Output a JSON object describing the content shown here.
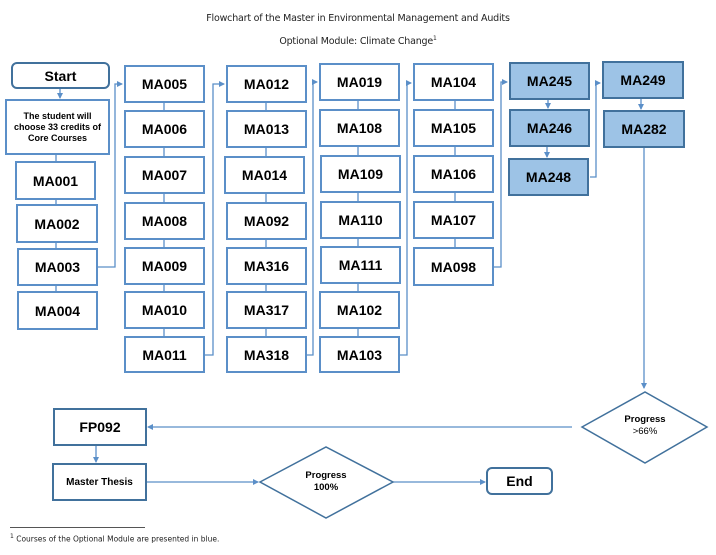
{
  "header": {
    "title": "Flowchart of the Master in Environmental Management and Audits",
    "subtitle": "Optional Module: Climate Change",
    "subtitle_marker": "1"
  },
  "colors": {
    "line": "#5b8fc8",
    "optional_fill": "#9dc3e6",
    "optional_border": "#41719c"
  },
  "start": {
    "label": "Start"
  },
  "intro": {
    "label": "The student will choose 33 credits of Core Courses"
  },
  "columns": [
    {
      "optional": false,
      "courses": [
        "MA001",
        "MA002",
        "MA003",
        "MA004"
      ]
    },
    {
      "optional": false,
      "courses": [
        "MA005",
        "MA006",
        "MA007",
        "MA008",
        "MA009",
        "MA010",
        "MA011"
      ]
    },
    {
      "optional": false,
      "courses": [
        "MA012",
        "MA013",
        "MA014",
        "MA092",
        "MA316",
        "MA317",
        "MA318"
      ]
    },
    {
      "optional": false,
      "courses": [
        "MA019",
        "MA108",
        "MA109",
        "MA110",
        "MA111",
        "MA102",
        "MA103"
      ]
    },
    {
      "optional": false,
      "courses": [
        "MA104",
        "MA105",
        "MA106",
        "MA107",
        "MA098"
      ]
    },
    {
      "optional": true,
      "courses": [
        "MA245",
        "MA246",
        "MA248"
      ]
    },
    {
      "optional": true,
      "courses": [
        "MA249",
        "MA282"
      ]
    }
  ],
  "decisions": {
    "progress_66": {
      "line1": "Progress",
      "line2": ">66%"
    },
    "progress_100": {
      "line1": "Progress",
      "line2": "100%"
    }
  },
  "final": {
    "project": "FP092",
    "thesis": "Master Thesis",
    "end": "End"
  },
  "footnote": {
    "marker": "1",
    "text": "Courses of the Optional Module are presented in blue."
  }
}
